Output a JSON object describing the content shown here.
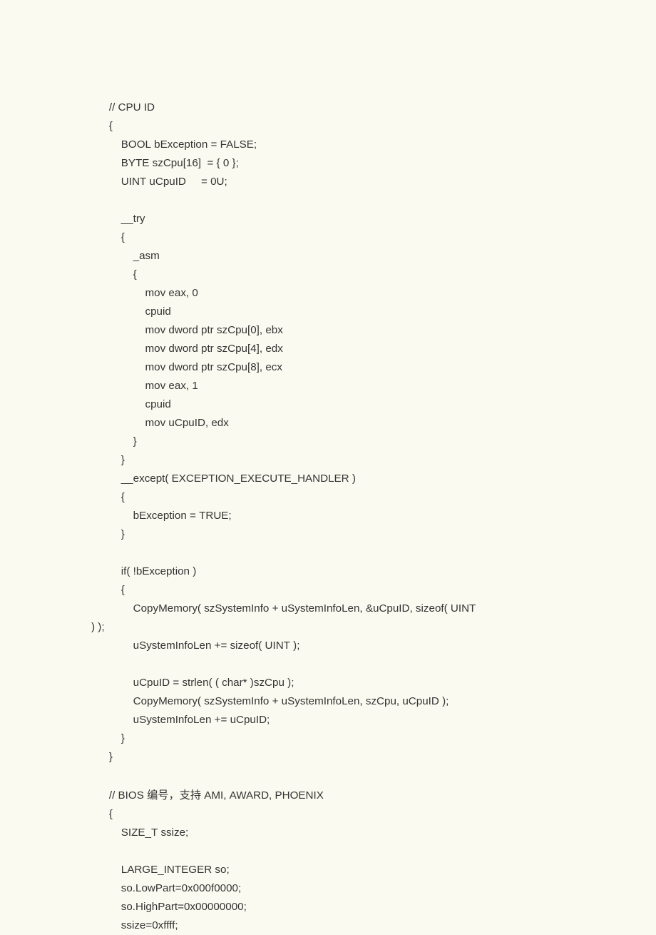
{
  "code": {
    "lines": [
      "    // CPU ID",
      "    {",
      "        BOOL bException = FALSE;",
      "        BYTE szCpu[16]  = { 0 };",
      "        UINT uCpuID     = 0U;",
      "",
      "        __try",
      "        {",
      "            _asm",
      "            {",
      "                mov eax, 0",
      "                cpuid",
      "                mov dword ptr szCpu[0], ebx",
      "                mov dword ptr szCpu[4], edx",
      "                mov dword ptr szCpu[8], ecx",
      "                mov eax, 1",
      "                cpuid",
      "                mov uCpuID, edx",
      "            }",
      "        }",
      "        __except( EXCEPTION_EXECUTE_HANDLER )",
      "        {",
      "            bException = TRUE;",
      "        }",
      "",
      "        if( !bException )",
      "        {",
      "            CopyMemory( szSystemInfo + uSystemInfoLen, &uCpuID, sizeof( UINT",
      ") );",
      "            uSystemInfoLen += sizeof( UINT );",
      "",
      "            uCpuID = strlen( ( char* )szCpu );",
      "            CopyMemory( szSystemInfo + uSystemInfoLen, szCpu, uCpuID );",
      "            uSystemInfoLen += uCpuID;",
      "        }",
      "    }",
      "",
      "    // BIOS 编号，支持 AMI, AWARD, PHOENIX",
      "    {",
      "        SIZE_T ssize;",
      "",
      "        LARGE_INTEGER so;",
      "        so.LowPart=0x000f0000;",
      "        so.HighPart=0x00000000;",
      "        ssize=0xffff;"
    ]
  }
}
